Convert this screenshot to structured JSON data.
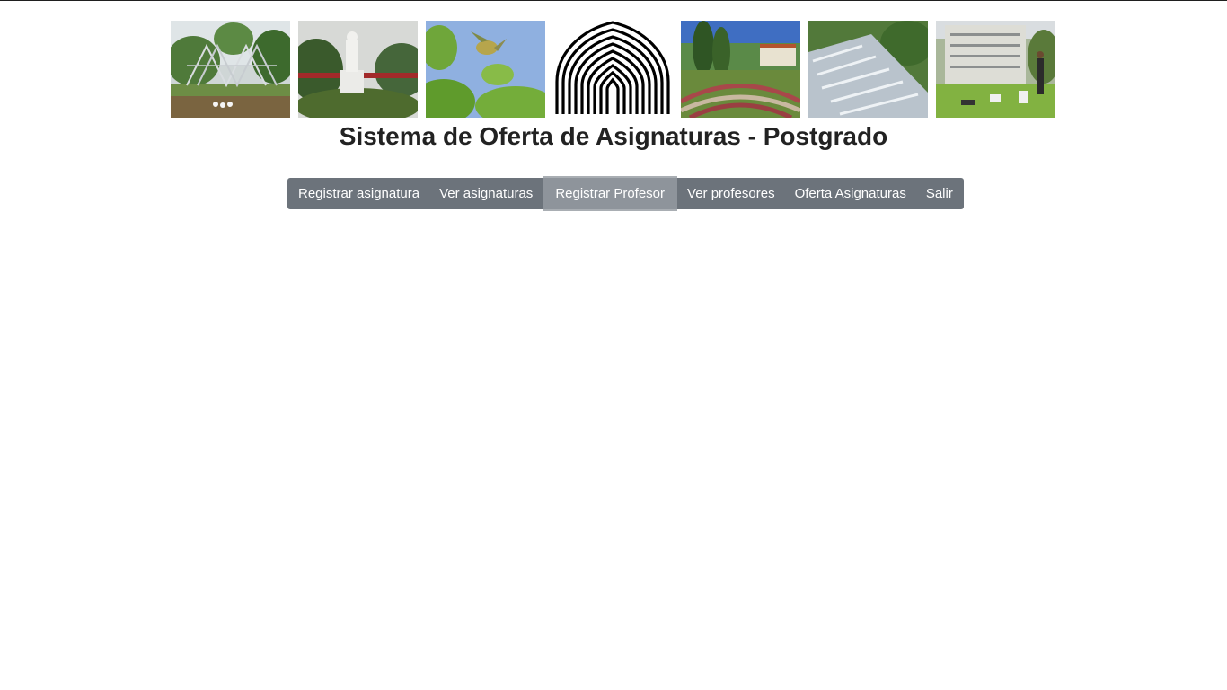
{
  "header": {
    "title": "Sistema de Oferta de Asignaturas - Postgrado",
    "photos": [
      {
        "name": "photo-sculpture-pond"
      },
      {
        "name": "photo-statue-garden"
      },
      {
        "name": "photo-bird-branch"
      },
      {
        "name": "photo-campus-garden"
      },
      {
        "name": "photo-water-steps"
      },
      {
        "name": "photo-students-lawn"
      }
    ],
    "logo_icon": "university-vault-logo"
  },
  "nav": {
    "items": [
      {
        "label": "Registrar asignatura",
        "active": false
      },
      {
        "label": "Ver asignaturas",
        "active": false
      },
      {
        "label": "Registrar Profesor",
        "active": true
      },
      {
        "label": "Ver profesores",
        "active": false
      },
      {
        "label": "Oferta Asignaturas",
        "active": false
      },
      {
        "label": "Salir",
        "active": false
      }
    ]
  },
  "colors": {
    "navbar": "#6c737b",
    "navbar_active": "#8e949b",
    "title": "#222222"
  }
}
